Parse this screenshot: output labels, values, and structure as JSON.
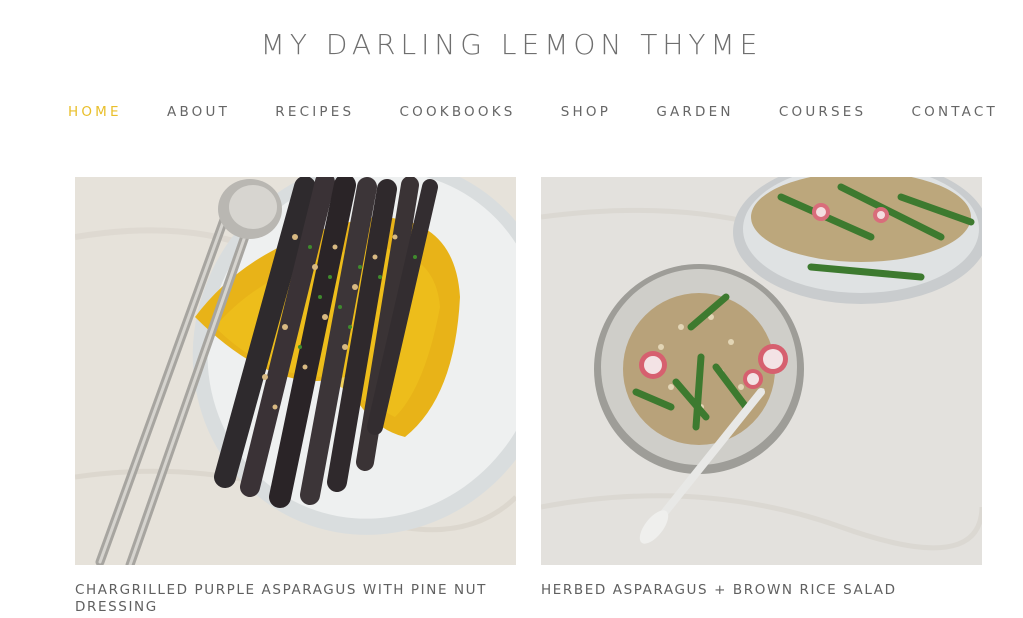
{
  "site": {
    "title": "MY DARLING LEMON THYME"
  },
  "nav": {
    "items": [
      {
        "label": "HOME",
        "active": true
      },
      {
        "label": "ABOUT"
      },
      {
        "label": "RECIPES"
      },
      {
        "label": "COOKBOOKS"
      },
      {
        "label": "SHOP"
      },
      {
        "label": "GARDEN"
      },
      {
        "label": "COURSES"
      },
      {
        "label": "CONTACT"
      }
    ],
    "active_color": "#e9bf2b"
  },
  "posts": [
    {
      "title": "CHARGRILLED PURPLE ASPARAGUS WITH PINE NUT DRESSING"
    },
    {
      "title": "HERBED ASPARAGUS + BROWN RICE SALAD"
    }
  ]
}
